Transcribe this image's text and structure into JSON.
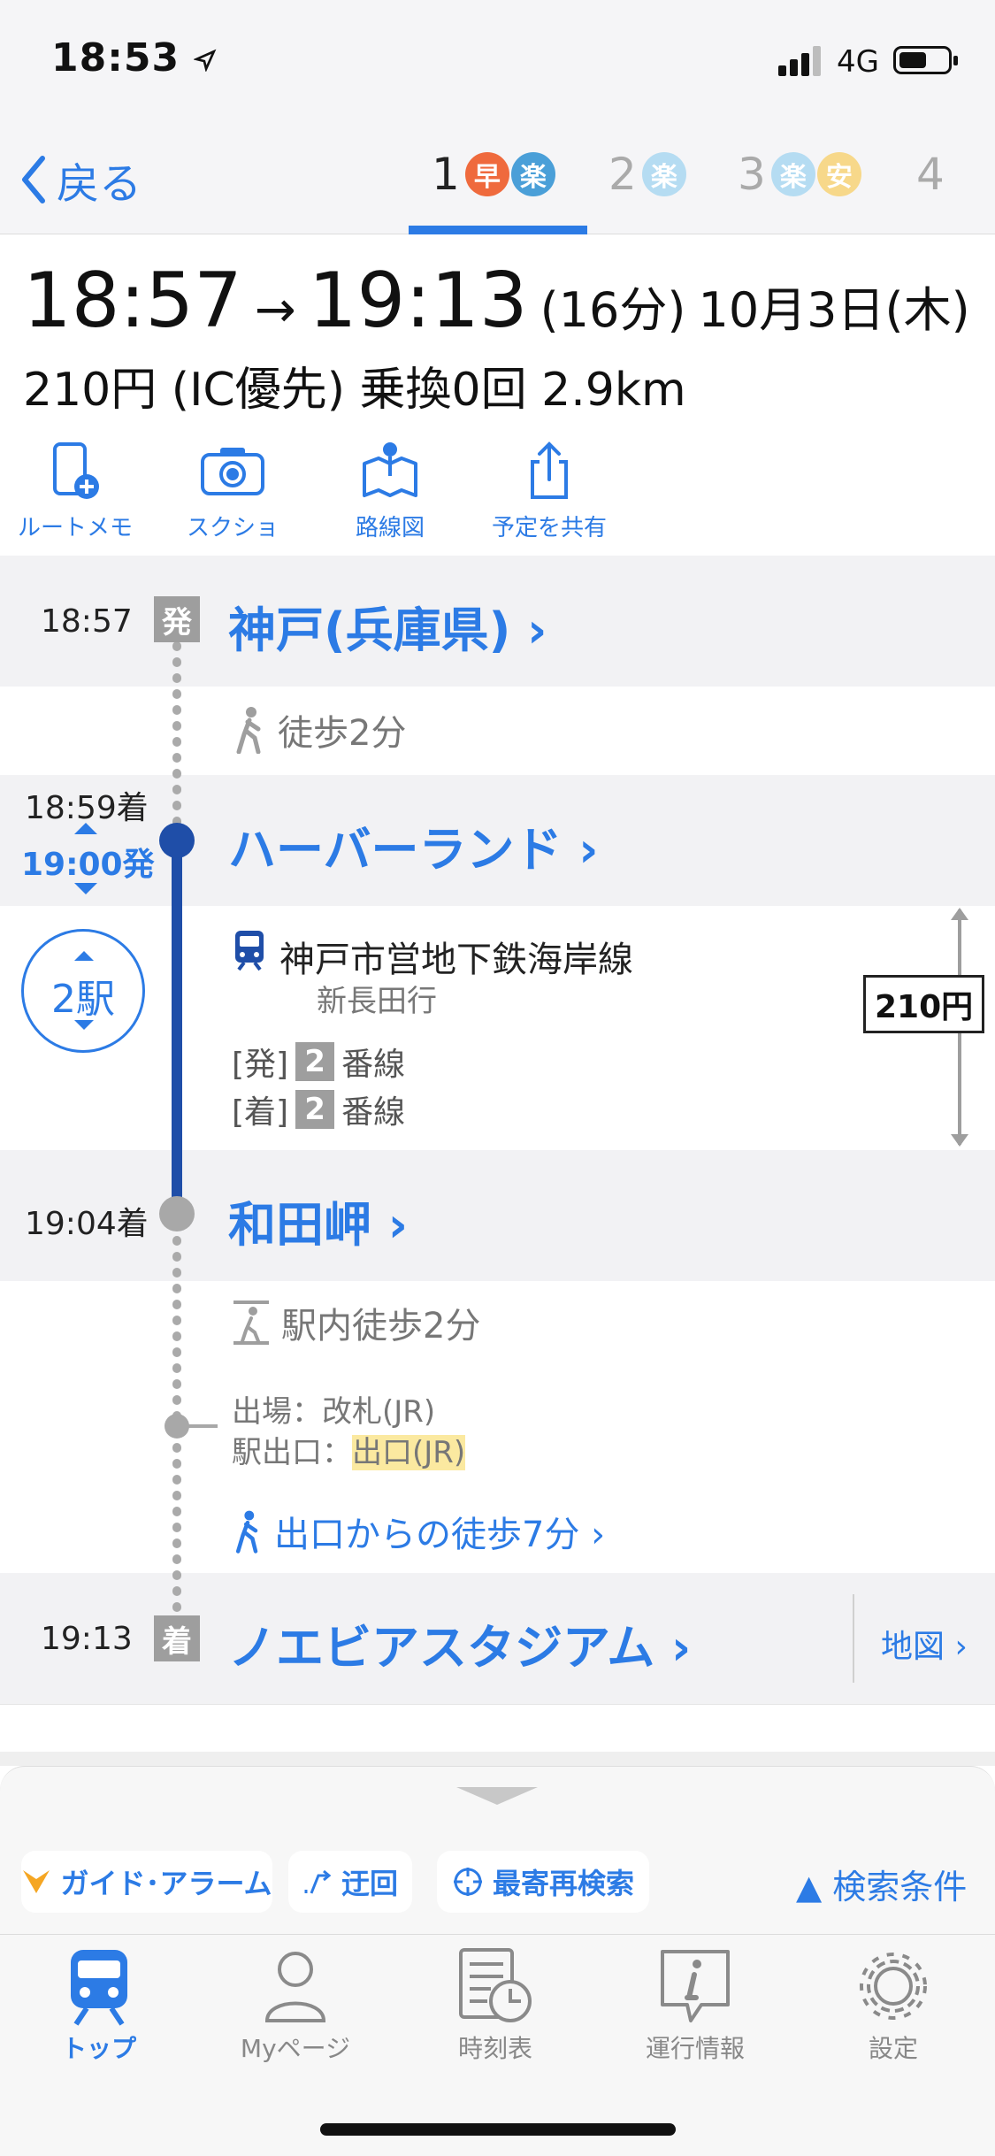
{
  "status": {
    "time": "18:53",
    "network": "4G"
  },
  "nav": {
    "back": "戻る",
    "tabs": [
      {
        "num": "1",
        "badges": [
          {
            "t": "早",
            "c": "#ef6a3d"
          },
          {
            "t": "楽",
            "c": "#4a9fd8"
          }
        ]
      },
      {
        "num": "2",
        "badges": [
          {
            "t": "楽",
            "c": "#b5dcf2"
          }
        ]
      },
      {
        "num": "3",
        "badges": [
          {
            "t": "楽",
            "c": "#b5dcf2"
          },
          {
            "t": "安",
            "c": "#f7d88a"
          }
        ]
      },
      {
        "num": "4",
        "badges": []
      }
    ]
  },
  "summary": {
    "depart": "18:57",
    "arrow": "→",
    "arrive": "19:13",
    "duration": "(16分)",
    "date": "10月3日(木)",
    "fare_line": "210円 (IC優先) 乗換0回 2.9km"
  },
  "actions": [
    {
      "label": "ルートメモ",
      "icon": "phone-add-icon"
    },
    {
      "label": "スクショ",
      "icon": "camera-icon"
    },
    {
      "label": "路線図",
      "icon": "map-pin-icon"
    },
    {
      "label": "予定を共有",
      "icon": "share-icon"
    }
  ],
  "route": {
    "origin": {
      "time": "18:57",
      "tag": "発",
      "name": "神戸(兵庫県) ›"
    },
    "walk1": "徒歩2分",
    "harborland": {
      "arr": "18:59着",
      "dep": "19:00発",
      "name": "ハーバーランド ›"
    },
    "stops": "2駅",
    "line": {
      "name": "神戸市営地下鉄海岸線",
      "dest": "新長田行",
      "dep_label": "[発]",
      "arr_label": "[着]",
      "platform": "2",
      "platform_suffix": "番線",
      "fare": "210円"
    },
    "wadamisaki": {
      "arr": "19:04着",
      "name": "和田岬 ›"
    },
    "walk2": "駅内徒歩2分",
    "exit": {
      "gate_label": "出場：改札(JR)",
      "exit_label": "駅出口：",
      "exit_value": "出口(JR)"
    },
    "walk3": "出口からの徒歩7分 ›",
    "dest": {
      "time": "19:13",
      "tag": "着",
      "name": "ノエビアスタジアム ›",
      "map": "地図 ›"
    }
  },
  "sheet": {
    "guide": "ガイド･アラーム",
    "detour": "迂回",
    "nearest": "最寄再検索",
    "conditions": "▲ 検索条件"
  },
  "tabbar": [
    {
      "label": "トップ",
      "active": true
    },
    {
      "label": "Myページ",
      "active": false
    },
    {
      "label": "時刻表",
      "active": false
    },
    {
      "label": "運行情報",
      "active": false
    },
    {
      "label": "設定",
      "active": false
    }
  ]
}
